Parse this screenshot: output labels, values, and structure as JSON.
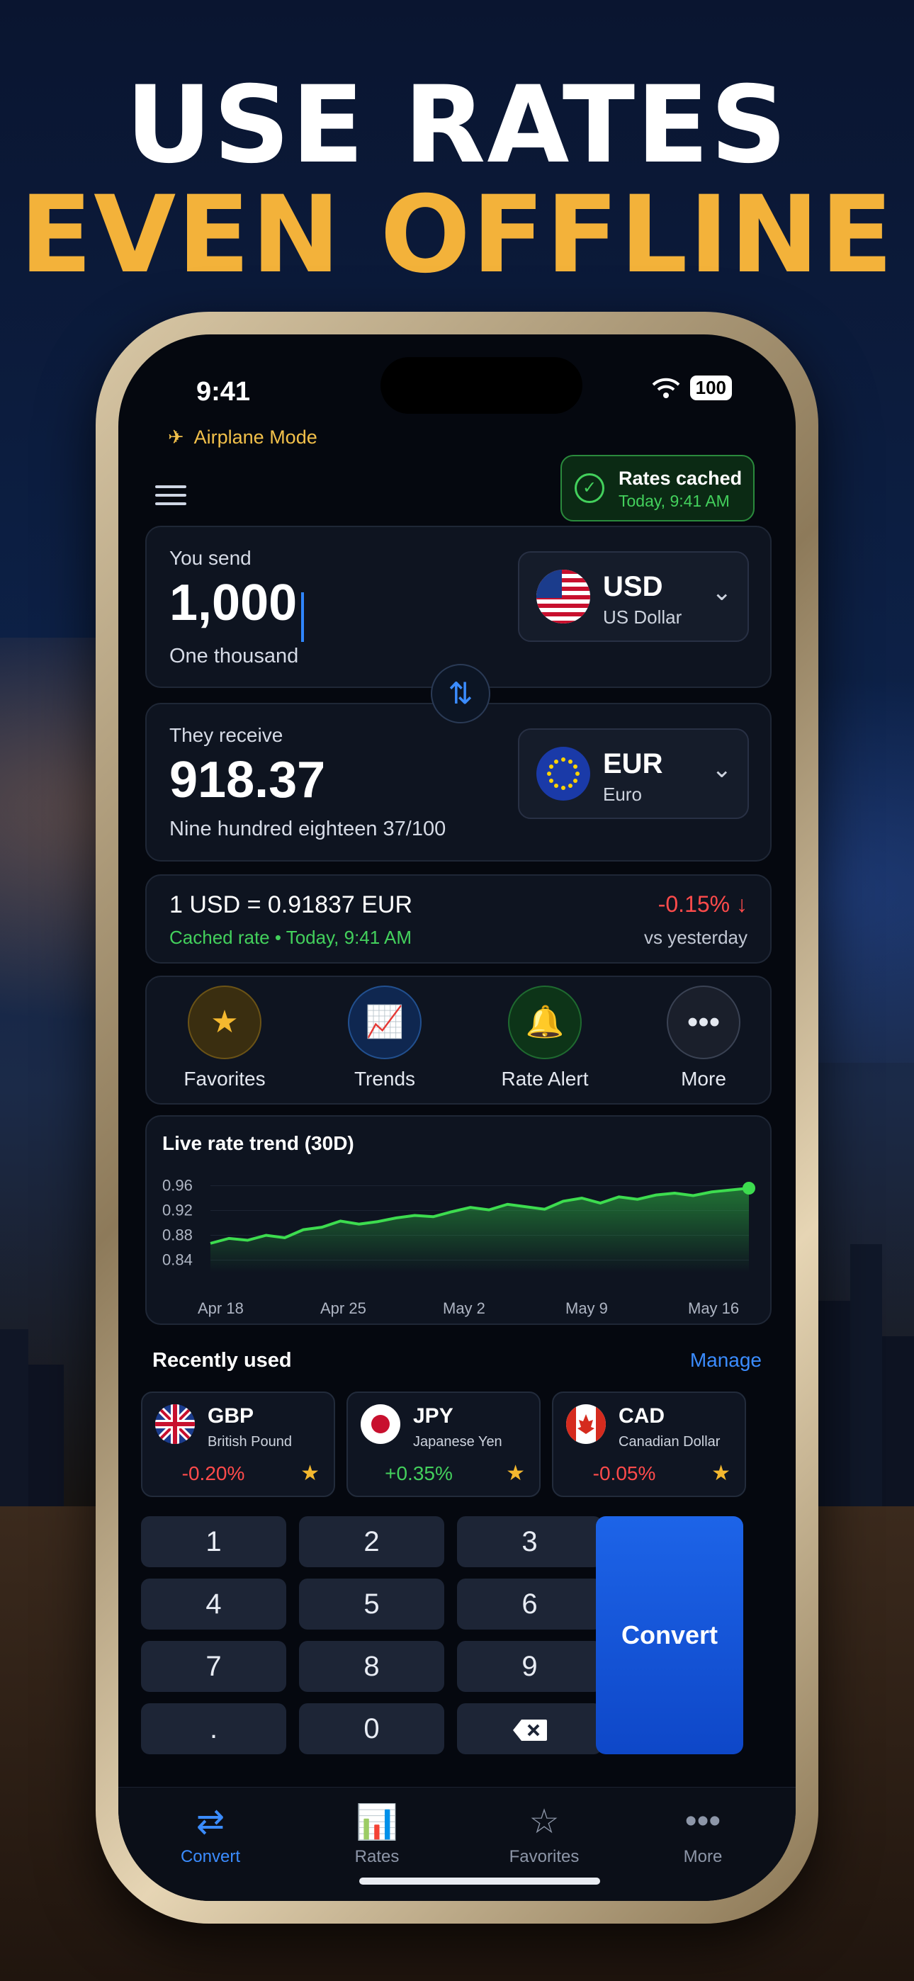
{
  "headline": {
    "line1": "USE RATES",
    "line2": "EVEN OFFLINE"
  },
  "status": {
    "time": "9:41",
    "battery": "100",
    "airplane_label": "Airplane Mode"
  },
  "cached_badge": {
    "title": "Rates cached",
    "subtitle": "Today, 9:41 AM"
  },
  "send": {
    "label": "You send",
    "amount": "1,000",
    "words": "One thousand",
    "currency_code": "USD",
    "currency_name": "US Dollar"
  },
  "receive": {
    "label": "They receive",
    "amount": "918.37",
    "words": "Nine hundred eighteen 37/100",
    "currency_code": "EUR",
    "currency_name": "Euro"
  },
  "rate": {
    "main": "1 USD = 0.91837 EUR",
    "sub": "Cached rate • Today, 9:41 AM",
    "change": "-0.15%",
    "change_icon": "arrow-down-icon",
    "vs": "vs yesterday"
  },
  "actions": [
    {
      "label": "Favorites",
      "icon": "star-icon"
    },
    {
      "label": "Trends",
      "icon": "trend-icon"
    },
    {
      "label": "Rate Alert",
      "icon": "bell-icon"
    },
    {
      "label": "More",
      "icon": "more-icon"
    }
  ],
  "chart_data": {
    "type": "area",
    "title": "Live rate trend (30D)",
    "x_ticks": [
      "Apr 18",
      "Apr 25",
      "May 2",
      "May 9",
      "May 16"
    ],
    "y_ticks": [
      "0.96",
      "0.92",
      "0.88",
      "0.84"
    ],
    "ylim": [
      0.82,
      0.98
    ],
    "series": [
      {
        "values": [
          0.867,
          0.875,
          0.872,
          0.88,
          0.876,
          0.889,
          0.893,
          0.903,
          0.898,
          0.902,
          0.908,
          0.912,
          0.91,
          0.918,
          0.925,
          0.921,
          0.93,
          0.926,
          0.922,
          0.935,
          0.94,
          0.932,
          0.942,
          0.938,
          0.945,
          0.948,
          0.944,
          0.95,
          0.953,
          0.956
        ],
        "color": "#3ddc4f"
      }
    ]
  },
  "recent": {
    "title": "Recently used",
    "manage_label": "Manage",
    "items": [
      {
        "code": "GBP",
        "name": "British Pound",
        "change": "-0.20%",
        "color": "#ff4b4b"
      },
      {
        "code": "JPY",
        "name": "Japanese Yen",
        "change": "+0.35%",
        "color": "#43d05c"
      },
      {
        "code": "CAD",
        "name": "Canadian Dollar",
        "change": "-0.05%",
        "color": "#ff4b4b"
      }
    ]
  },
  "keypad": {
    "keys": [
      "1",
      "2",
      "3",
      "4",
      "5",
      "6",
      "7",
      "8",
      "9",
      ".",
      "0"
    ],
    "backspace_icon": "backspace-icon",
    "convert_label": "Convert"
  },
  "tabs": [
    {
      "label": "Convert",
      "icon": "convert-icon",
      "active": true
    },
    {
      "label": "Rates",
      "icon": "bar-chart-icon",
      "active": false
    },
    {
      "label": "Favorites",
      "icon": "star-outline-icon",
      "active": false
    },
    {
      "label": "More",
      "icon": "more-icon",
      "active": false
    }
  ],
  "colors": {
    "accent": "#2f86ff",
    "positive": "#43d05c",
    "negative": "#ff4b4b",
    "gold": "#f3b23a"
  }
}
